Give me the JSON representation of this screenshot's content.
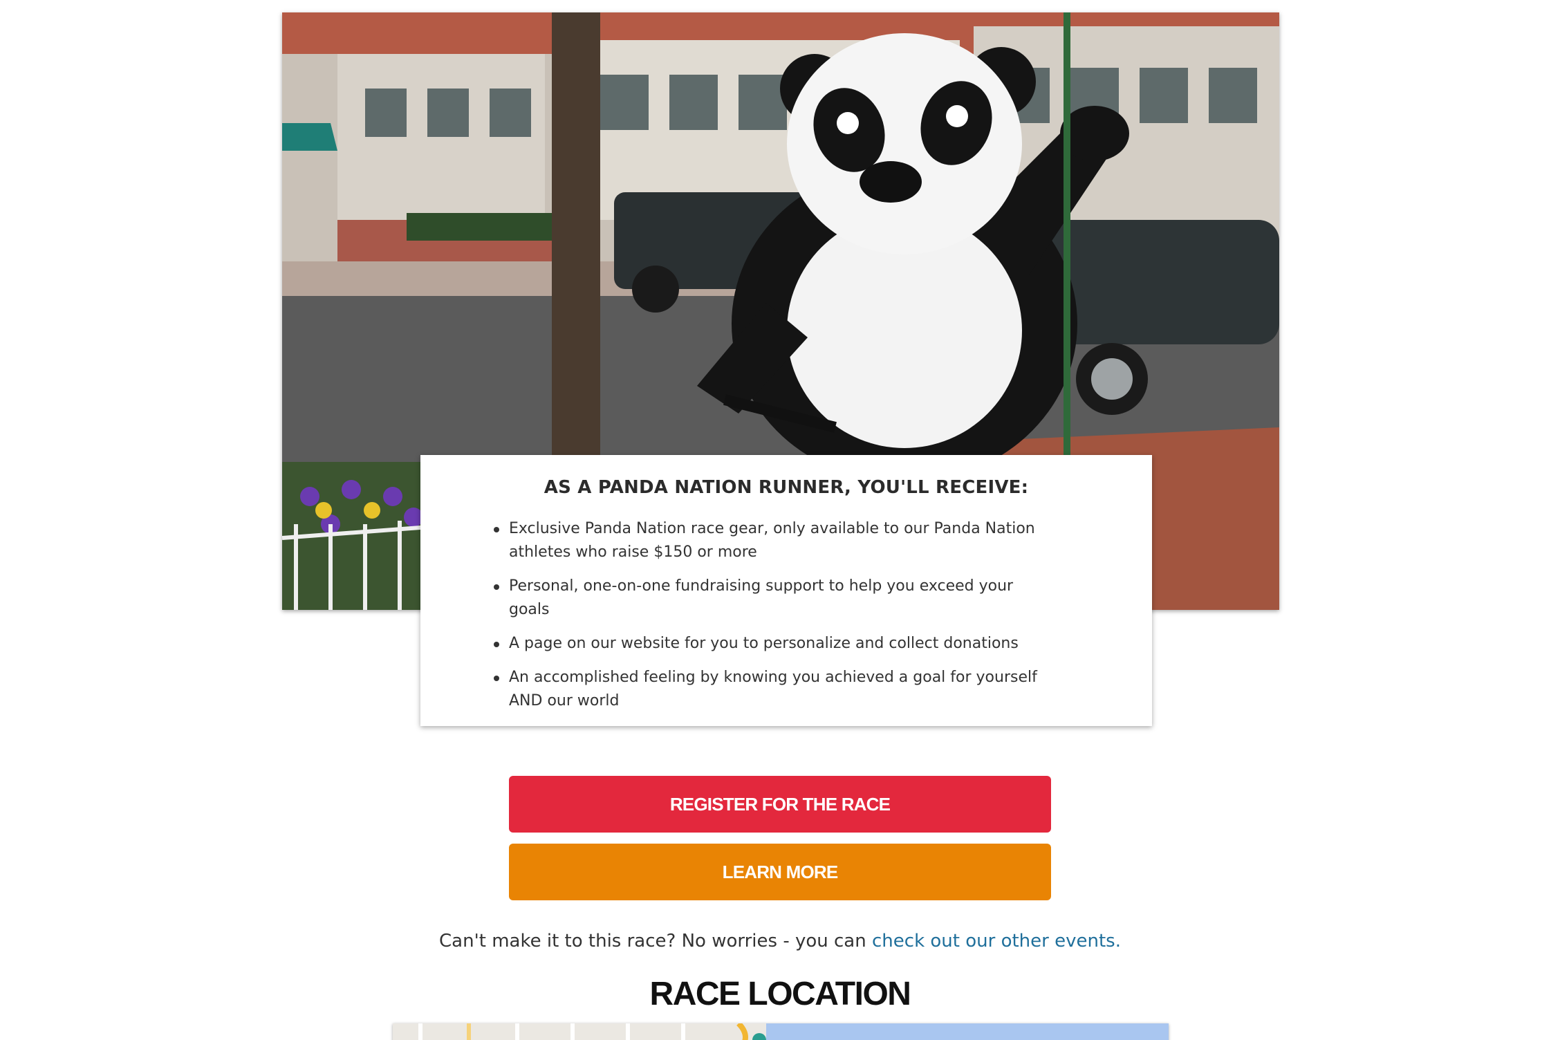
{
  "hero": {
    "image_label": "Person in panda costume waving while riding a bicycle on a city street"
  },
  "benefits_card": {
    "title": "AS A PANDA NATION RUNNER, YOU'LL RECEIVE:",
    "items": [
      {
        "text": "Exclusive Panda Nation race gear, only available to our Panda Nation athletes who raise $150 or more"
      },
      {
        "text": "Personal, one-on-one fundraising support to help you exceed your goals"
      },
      {
        "text": "A page on our website for you to personalize and collect donations"
      },
      {
        "text": "An accomplished feeling by knowing you achieved a goal for yourself AND our world"
      }
    ]
  },
  "buttons": {
    "register_label": "REGISTER FOR THE RACE",
    "learn_more_label": "LEARN MORE"
  },
  "other_events": {
    "prefix": "Can't make it to this race? No worries - you can ",
    "link_text": "check out our other events."
  },
  "race_location": {
    "title": "RACE LOCATION"
  },
  "colors": {
    "register_button": "#e3283d",
    "learn_more_button": "#e98404",
    "link": "#1f6f9b"
  }
}
